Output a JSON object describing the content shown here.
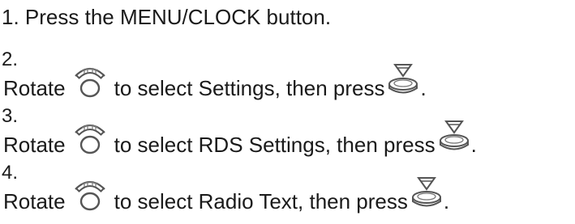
{
  "steps": [
    {
      "number": "1.",
      "text": "Press the MENU/CLOCK button."
    },
    {
      "number": "2.",
      "rotate_label": "Rotate",
      "select_text": "to select Settings, then press",
      "end_text": ".",
      "dial_icon": "rotary-dial-icon",
      "press_icon": "press-knob-icon"
    },
    {
      "number": "3.",
      "rotate_label": "Rotate",
      "select_text": "to select RDS Settings, then press",
      "end_text": ".",
      "dial_icon": "rotary-dial-icon",
      "press_icon": "press-knob-icon"
    },
    {
      "number": "4.",
      "rotate_label": "Rotate",
      "select_text": "to select Radio Text, then press",
      "end_text": ".",
      "dial_icon": "rotary-dial-icon",
      "press_icon": "press-knob-icon"
    }
  ]
}
